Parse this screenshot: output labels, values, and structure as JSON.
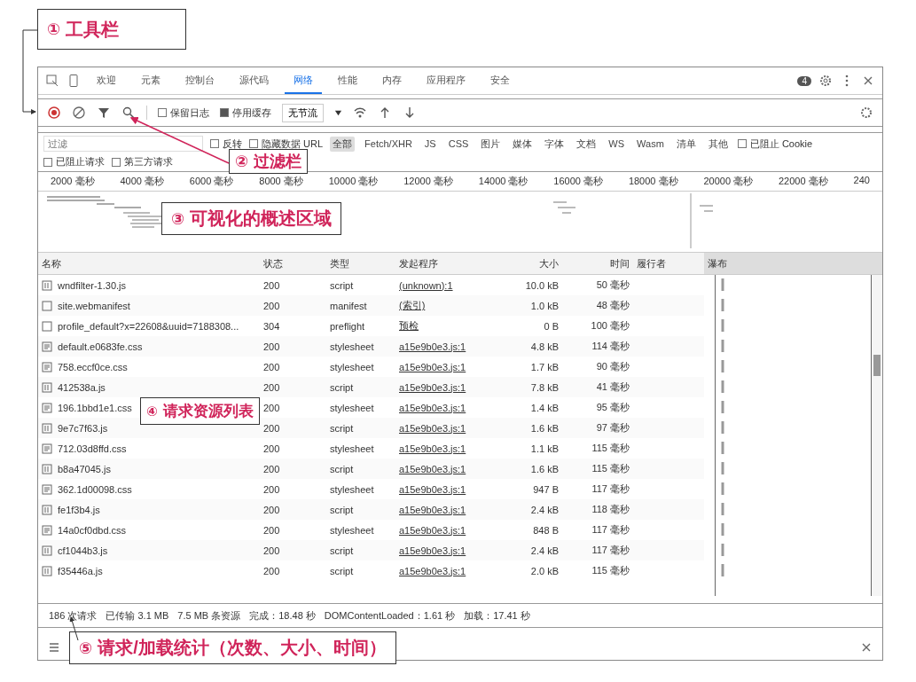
{
  "annotations": [
    {
      "number": "①",
      "label": "工具栏"
    },
    {
      "number": "②",
      "label": "过滤栏"
    },
    {
      "number": "③",
      "label": "可视化的概述区域"
    },
    {
      "number": "④",
      "label": "请求资源列表"
    },
    {
      "number": "⑤",
      "label": "请求/加载统计（次数、大小、时间）"
    }
  ],
  "tabs": [
    {
      "label": "欢迎",
      "selected": false
    },
    {
      "label": "元素",
      "selected": false
    },
    {
      "label": "控制台",
      "selected": false
    },
    {
      "label": "源代码",
      "selected": false
    },
    {
      "label": "网络",
      "selected": true
    },
    {
      "label": "性能",
      "selected": false
    },
    {
      "label": "内存",
      "selected": false
    },
    {
      "label": "应用程序",
      "selected": false
    },
    {
      "label": "安全",
      "selected": false
    }
  ],
  "issue_count": "4",
  "toolbar": {
    "preserve_log": {
      "label": "保留日志",
      "checked": false
    },
    "disable_cache": {
      "label": "停用缓存",
      "checked": true
    },
    "throttling": "无节流"
  },
  "filter": {
    "placeholder": "过滤",
    "invert": {
      "label": "反转",
      "checked": false
    },
    "hide_data_urls": {
      "label": "隐藏数据 URL",
      "checked": false
    },
    "types": [
      {
        "label": "全部",
        "selected": true
      },
      {
        "label": "Fetch/XHR",
        "selected": false
      },
      {
        "label": "JS",
        "selected": false
      },
      {
        "label": "CSS",
        "selected": false
      },
      {
        "label": "图片",
        "selected": false
      },
      {
        "label": "媒体",
        "selected": false
      },
      {
        "label": "字体",
        "selected": false
      },
      {
        "label": "文档",
        "selected": false
      },
      {
        "label": "WS",
        "selected": false
      },
      {
        "label": "Wasm",
        "selected": false
      },
      {
        "label": "清单",
        "selected": false
      },
      {
        "label": "其他",
        "selected": false
      }
    ],
    "blocked_cookies": {
      "label": "已阻止 Cookie",
      "checked": false
    },
    "blocked_requests": {
      "label": "已阻止请求",
      "checked": false
    },
    "third_party": {
      "label": "第三方请求",
      "checked": false
    }
  },
  "overview_ticks": [
    "2000 毫秒",
    "4000 毫秒",
    "6000 毫秒",
    "8000 毫秒",
    "10000 毫秒",
    "12000 毫秒",
    "14000 毫秒",
    "16000 毫秒",
    "18000 毫秒",
    "20000 毫秒",
    "22000 毫秒",
    "240"
  ],
  "table": {
    "columns": [
      "名称",
      "状态",
      "类型",
      "发起程序",
      "大小",
      "时间",
      "履行者",
      "瀑布"
    ],
    "rows": [
      {
        "name": "wndfilter-1.30.js",
        "status": "200",
        "type": "script",
        "initiator": "(unknown):1",
        "size": "10.0 kB",
        "time": "50 毫秒"
      },
      {
        "name": "site.webmanifest",
        "status": "200",
        "type": "manifest",
        "initiator": "(索引)",
        "size": "1.0 kB",
        "time": "48 毫秒"
      },
      {
        "name": "profile_default?x=22608&uuid=7188308...",
        "status": "304",
        "type": "preflight",
        "initiator": "预检",
        "size": "0 B",
        "time": "100 毫秒"
      },
      {
        "name": "default.e0683fe.css",
        "status": "200",
        "type": "stylesheet",
        "initiator": "a15e9b0e3.js:1",
        "size": "4.8 kB",
        "time": "114 毫秒"
      },
      {
        "name": "758.eccf0ce.css",
        "status": "200",
        "type": "stylesheet",
        "initiator": "a15e9b0e3.js:1",
        "size": "1.7 kB",
        "time": "90 毫秒"
      },
      {
        "name": "412538a.js",
        "status": "200",
        "type": "script",
        "initiator": "a15e9b0e3.js:1",
        "size": "7.8 kB",
        "time": "41 毫秒"
      },
      {
        "name": "196.1bbd1e1.css",
        "status": "200",
        "type": "stylesheet",
        "initiator": "a15e9b0e3.js:1",
        "size": "1.4 kB",
        "time": "95 毫秒"
      },
      {
        "name": "9e7c7f63.js",
        "status": "200",
        "type": "script",
        "initiator": "a15e9b0e3.js:1",
        "size": "1.6 kB",
        "time": "97 毫秒"
      },
      {
        "name": "712.03d8ffd.css",
        "status": "200",
        "type": "stylesheet",
        "initiator": "a15e9b0e3.js:1",
        "size": "1.1 kB",
        "time": "115 毫秒"
      },
      {
        "name": "b8a47045.js",
        "status": "200",
        "type": "script",
        "initiator": "a15e9b0e3.js:1",
        "size": "1.6 kB",
        "time": "115 毫秒"
      },
      {
        "name": "362.1d00098.css",
        "status": "200",
        "type": "stylesheet",
        "initiator": "a15e9b0e3.js:1",
        "size": "947 B",
        "time": "117 毫秒"
      },
      {
        "name": "fe1f3b4.js",
        "status": "200",
        "type": "script",
        "initiator": "a15e9b0e3.js:1",
        "size": "2.4 kB",
        "time": "118 毫秒"
      },
      {
        "name": "14a0cf0dbd.css",
        "status": "200",
        "type": "stylesheet",
        "initiator": "a15e9b0e3.js:1",
        "size": "848 B",
        "time": "117 毫秒"
      },
      {
        "name": "cf1044b3.js",
        "status": "200",
        "type": "script",
        "initiator": "a15e9b0e3.js:1",
        "size": "2.4 kB",
        "time": "117 毫秒"
      },
      {
        "name": "f35446a.js",
        "status": "200",
        "type": "script",
        "initiator": "a15e9b0e3.js:1",
        "size": "2.0 kB",
        "time": "115 毫秒"
      }
    ]
  },
  "status_bar": [
    "186 次请求",
    "已传输 3.1 MB",
    "7.5 MB 条资源",
    "完成：18.48 秒",
    "DOMContentLoaded：1.61 秒",
    "加载：17.41 秒"
  ]
}
